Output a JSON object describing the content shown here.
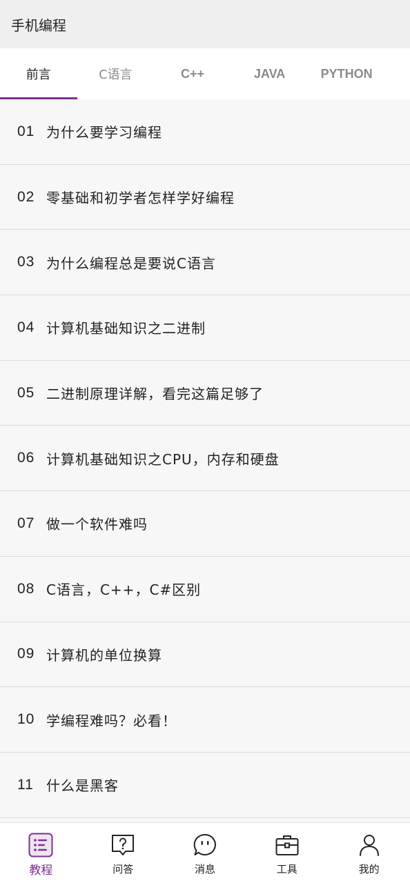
{
  "colors": {
    "accent": "#7b2f8e",
    "active_icon_bg": "#efe4f2"
  },
  "header": {
    "title": "手机编程"
  },
  "tabs": [
    {
      "label": "前言",
      "active": true
    },
    {
      "label": "C语言",
      "active": false
    },
    {
      "label": "C++",
      "active": false
    },
    {
      "label": "JAVA",
      "active": false
    },
    {
      "label": "PYTHON",
      "active": false
    }
  ],
  "articles": [
    {
      "num": "01",
      "title": "为什么要学习编程"
    },
    {
      "num": "02",
      "title": "零基础和初学者怎样学好编程"
    },
    {
      "num": "03",
      "title": "为什么编程总是要说C语言"
    },
    {
      "num": "04",
      "title": "计算机基础知识之二进制"
    },
    {
      "num": "05",
      "title": "二进制原理详解，看完这篇足够了"
    },
    {
      "num": "06",
      "title": "计算机基础知识之CPU，内存和硬盘"
    },
    {
      "num": "07",
      "title": "做一个软件难吗"
    },
    {
      "num": "08",
      "title": "C语言，C++，C#区别"
    },
    {
      "num": "09",
      "title": "计算机的单位换算"
    },
    {
      "num": "10",
      "title": "学编程难吗？必看！"
    },
    {
      "num": "11",
      "title": "什么是黑客"
    }
  ],
  "bottom_nav": [
    {
      "label": "教程",
      "icon": "list-icon",
      "active": true
    },
    {
      "label": "问答",
      "icon": "question-chat-icon",
      "active": false
    },
    {
      "label": "消息",
      "icon": "message-bubble-icon",
      "active": false
    },
    {
      "label": "工具",
      "icon": "toolbox-icon",
      "active": false
    },
    {
      "label": "我的",
      "icon": "user-icon",
      "active": false
    }
  ]
}
